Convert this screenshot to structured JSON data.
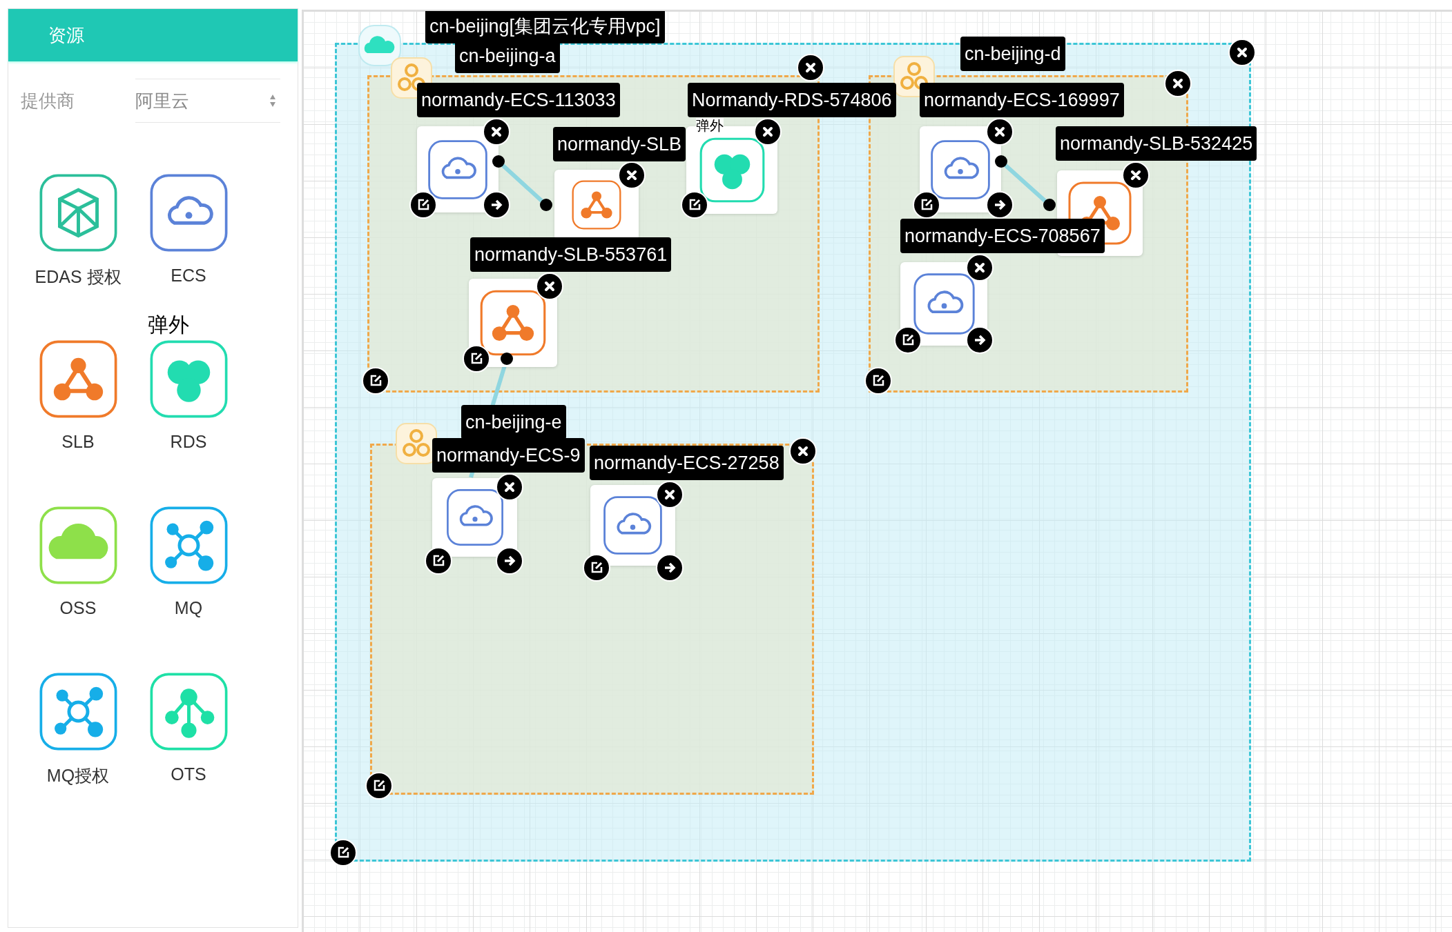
{
  "sidebar": {
    "title": "资源",
    "provider": {
      "label": "提供商",
      "value": "阿里云"
    },
    "resources": [
      {
        "label": "EDAS 授权",
        "kind": "edas"
      },
      {
        "label": "ECS",
        "kind": "ecs"
      },
      {
        "label": "SLB",
        "kind": "slb"
      },
      {
        "label": "RDS",
        "kind": "rds",
        "badge": "弹外"
      },
      {
        "label": "OSS",
        "kind": "oss"
      },
      {
        "label": "MQ",
        "kind": "mq"
      },
      {
        "label": "MQ授权",
        "kind": "mq"
      },
      {
        "label": "OTS",
        "kind": "ots"
      }
    ]
  },
  "canvas": {
    "vpc": {
      "label": "cn-beijing[集团云化专用vpc]",
      "zones": [
        {
          "label": "cn-beijing-a",
          "resources": [
            {
              "name": "normandy-ECS-113033",
              "kind": "ecs"
            },
            {
              "name": "normandy-SLB",
              "kind": "slb"
            },
            {
              "name": "Normandy-RDS-574806",
              "kind": "rds",
              "badge": "弹外"
            },
            {
              "name": "normandy-SLB-553761",
              "kind": "slb"
            }
          ]
        },
        {
          "label": "cn-beijing-d",
          "resources": [
            {
              "name": "normandy-ECS-169997",
              "kind": "ecs"
            },
            {
              "name": "normandy-SLB-532425",
              "kind": "slb"
            },
            {
              "name": "normandy-ECS-708567",
              "kind": "ecs"
            }
          ]
        },
        {
          "label": "cn-beijing-e",
          "resources": [
            {
              "name": "normandy-ECS-9",
              "kind": "ecs"
            },
            {
              "name": "normandy-ECS-27258",
              "kind": "ecs"
            }
          ]
        }
      ]
    }
  }
}
